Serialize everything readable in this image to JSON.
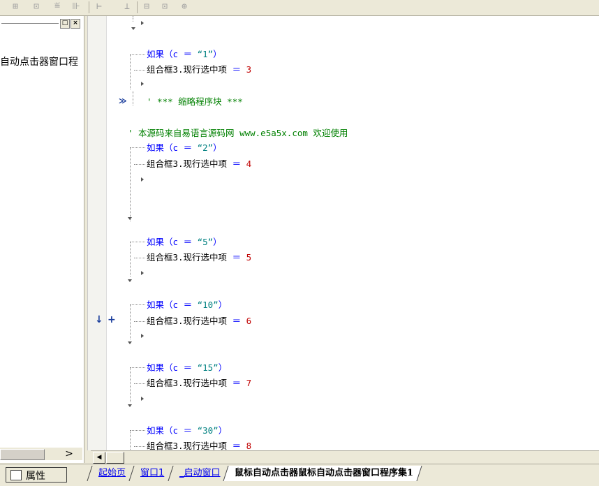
{
  "toolbar": {
    "icons": [
      "align-left-icon",
      "align-top-icon",
      "distribute-icon",
      "align-right-icon",
      "space-horizontal-icon",
      "space-vertical-icon",
      "same-width-icon",
      "same-height-icon",
      "same-size-icon"
    ]
  },
  "left_panel": {
    "text": "自动点击器窗口程",
    "pin_label": "□",
    "close_label": "×",
    "scroll_arrow": ">"
  },
  "code_lines": {
    "if1_kw": "如果",
    "if1_cond_open": "（c ＝ ",
    "if1_str": "“1”",
    "if1_cond_close": "）",
    "set1_txt": "组合框3.现行选中项",
    "set1_eq": " ＝ ",
    "set1_num": "3",
    "fold_comment": "' *** 缩略程序块 ***",
    "banner_comment": "' 本源码来自易语言源码网 www.e5a5x.com  欢迎使用",
    "if2_str": "“2”",
    "set2_num": "4",
    "if3_str": "“5”",
    "set3_num": "5",
    "if4_str": "“10”",
    "set4_num": "6",
    "if5_str": "“15”",
    "set5_num": "7",
    "if6_str": "“30”",
    "set6_num": "8"
  },
  "markers": {
    "fold_marker": "≫",
    "bp_arrow": "↓",
    "bp_plus": "+"
  },
  "bottom": {
    "properties_label": "属性",
    "tabs": [
      "起始页",
      "窗口1",
      "_启动窗口",
      "鼠标自动点击器鼠标自动点击器窗口程序集1"
    ]
  },
  "colors": {
    "keyword": "#0000ff",
    "string": "#008080",
    "number": "#c00000",
    "comment": "#008000"
  }
}
